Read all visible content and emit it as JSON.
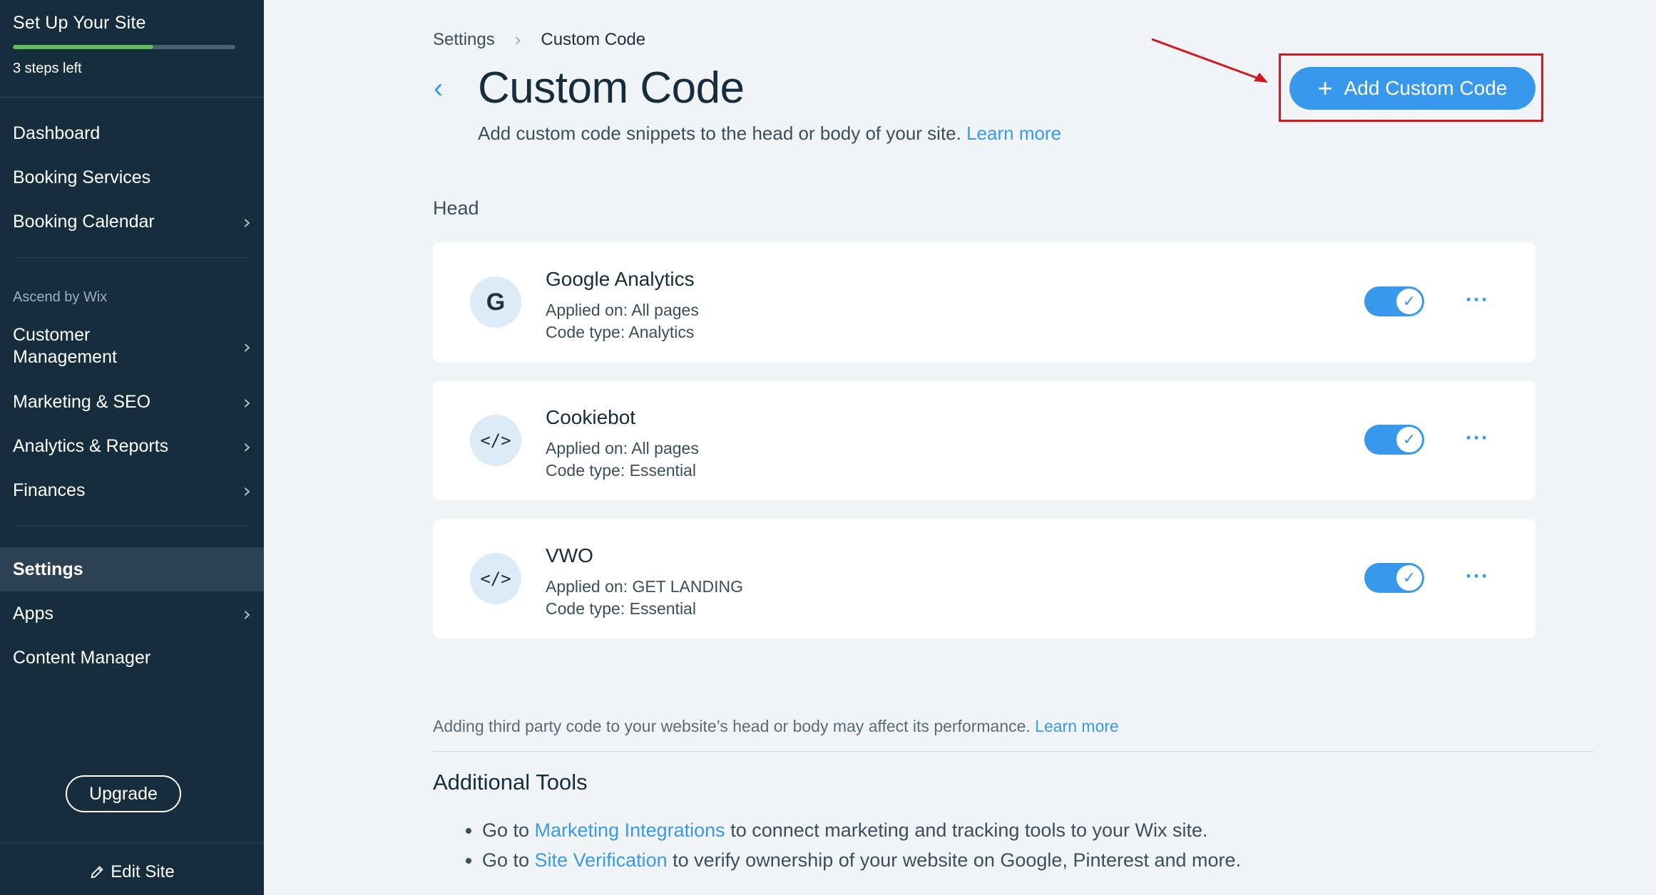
{
  "sidebar": {
    "setup_title": "Set Up Your Site",
    "progress_percent": 63,
    "steps_left": "3 steps left",
    "group1": [
      {
        "label": "Dashboard",
        "chevron": false
      },
      {
        "label": "Booking Services",
        "chevron": false
      },
      {
        "label": "Booking Calendar",
        "chevron": true
      }
    ],
    "section_label": "Ascend by Wix",
    "group2": [
      {
        "label": "Customer Management",
        "chevron": true
      },
      {
        "label": "Marketing & SEO",
        "chevron": true
      },
      {
        "label": "Analytics & Reports",
        "chevron": true
      },
      {
        "label": "Finances",
        "chevron": true
      }
    ],
    "group3": [
      {
        "label": "Settings",
        "chevron": false,
        "active": true
      },
      {
        "label": "Apps",
        "chevron": true
      },
      {
        "label": "Content Manager",
        "chevron": false
      }
    ],
    "upgrade_label": "Upgrade",
    "edit_site_label": "Edit Site"
  },
  "breadcrumb": {
    "parent": "Settings",
    "current": "Custom Code"
  },
  "page": {
    "title": "Custom Code",
    "subtitle": "Add custom code snippets to the head or body of your site.",
    "learn_more": "Learn more",
    "add_button": "Add Custom Code"
  },
  "head_section": {
    "label": "Head",
    "items": [
      {
        "icon": "google-icon",
        "icon_text": "G",
        "name": "Google Analytics",
        "applied": "Applied on: All pages",
        "type": "Code type: Analytics",
        "enabled": true
      },
      {
        "icon": "code-icon",
        "icon_text": "</>",
        "name": "Cookiebot",
        "applied": "Applied on: All pages",
        "type": "Code type: Essential",
        "enabled": true
      },
      {
        "icon": "code-icon",
        "icon_text": "</>",
        "name": "VWO",
        "applied": "Applied on: GET LANDING",
        "type": "Code type: Essential",
        "enabled": true
      }
    ]
  },
  "footer": {
    "note": "Adding third party code to your website’s head or body may affect its performance.",
    "note_link": "Learn more",
    "tools_title": "Additional Tools",
    "tools": [
      {
        "prefix": "Go to ",
        "link": "Marketing Integrations",
        "suffix": " to connect marketing and tracking tools to your Wix site."
      },
      {
        "prefix": "Go to ",
        "link": "Site Verification",
        "suffix": " to verify ownership of your website on Google, Pinterest and more."
      }
    ]
  },
  "colors": {
    "sidebar_bg": "#162d3d",
    "accent": "#3899ec",
    "progress": "#60bc57",
    "highlight": "#d6161e"
  }
}
